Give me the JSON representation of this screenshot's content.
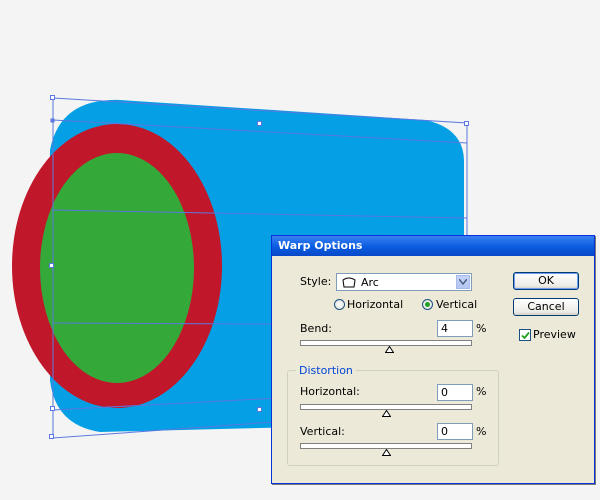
{
  "dialog": {
    "title": "Warp Options",
    "style_label": "Style:",
    "style_value": "Arc",
    "orientation": {
      "horizontal_label": "Horizontal",
      "vertical_label": "Vertical",
      "selected": "Vertical"
    },
    "bend": {
      "label": "Bend:",
      "value": "4",
      "unit": "%"
    },
    "distortion": {
      "title": "Distortion",
      "horizontal": {
        "label": "Horizontal:",
        "value": "0",
        "unit": "%"
      },
      "vertical": {
        "label": "Vertical:",
        "value": "0",
        "unit": "%"
      }
    },
    "ok_label": "OK",
    "cancel_label": "Cancel",
    "preview_label": "Preview",
    "preview_checked": true
  },
  "artwork": {
    "colors": {
      "blue": "#049fe4",
      "red": "#c1172b",
      "green": "#35a83a",
      "selection": "#5a78e0"
    }
  }
}
